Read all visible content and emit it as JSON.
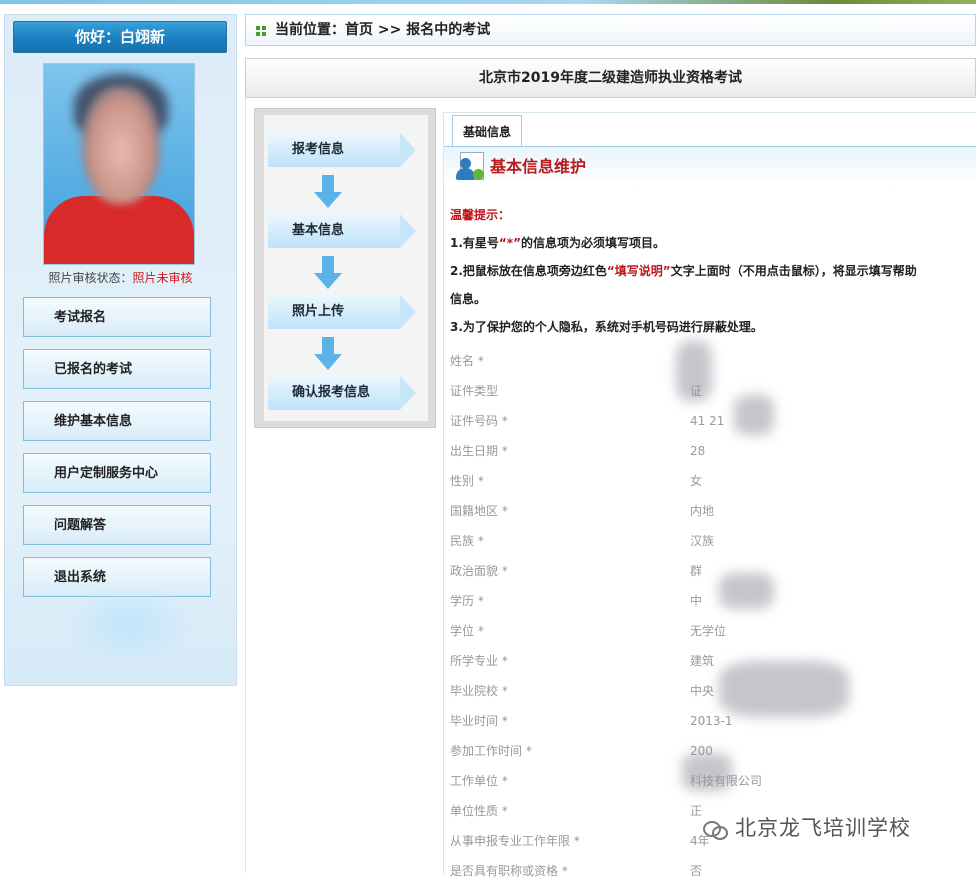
{
  "sidebar": {
    "greeting": "你好：白翊新",
    "photo_status_label": "照片审核状态：",
    "photo_status_value": "照片未审核",
    "menu": [
      {
        "label": "考试报名"
      },
      {
        "label": "已报名的考试"
      },
      {
        "label": "维护基本信息"
      },
      {
        "label": "用户定制服务中心"
      },
      {
        "label": "问题解答"
      },
      {
        "label": "退出系统"
      }
    ]
  },
  "breadcrumb": {
    "text": "当前位置：首页 >> 报名中的考试"
  },
  "exam_title": "北京市2019年度二级建造师执业资格考试",
  "steps": [
    {
      "label": "报考信息"
    },
    {
      "label": "基本信息"
    },
    {
      "label": "照片上传"
    },
    {
      "label": "确认报考信息"
    }
  ],
  "tab": {
    "label": "基础信息"
  },
  "section_title": "基本信息维护",
  "tips": {
    "heading": "温馨提示：",
    "line1_a": "1.有星号",
    "line1_b": "“*”",
    "line1_c": "的信息项为必须填写项目。",
    "line2_a": "2.把鼠标放在信息项旁边红色",
    "line2_b": "“填写说明”",
    "line2_c": "文字上面时（不用点击鼠标），将显示填写帮助",
    "line2_d": "信息。",
    "line3": "3.为了保护您的个人隐私，系统对手机号码进行屏蔽处理。"
  },
  "form": [
    {
      "label": "姓名 *",
      "value": ""
    },
    {
      "label": "证件类型",
      "value": "证"
    },
    {
      "label": "证件号码 *",
      "value": "41                21"
    },
    {
      "label": "出生日期 *",
      "value": "28"
    },
    {
      "label": "性别 *",
      "value": "女"
    },
    {
      "label": "国籍地区 *",
      "value": "内地"
    },
    {
      "label": "民族 *",
      "value": "汉族"
    },
    {
      "label": "政治面貌 *",
      "value": "群"
    },
    {
      "label": "学历 *",
      "value": "中"
    },
    {
      "label": "学位 *",
      "value": "无学位"
    },
    {
      "label": "所学专业 *",
      "value": "建筑"
    },
    {
      "label": "毕业院校 *",
      "value": "中央"
    },
    {
      "label": "毕业时间 *",
      "value": "2013-1"
    },
    {
      "label": "参加工作时间 *",
      "value": "200"
    },
    {
      "label": "工作单位 *",
      "value": "科技有限公司"
    },
    {
      "label": "单位性质 *",
      "value": "正"
    },
    {
      "label": "从事申报专业工作年限 *",
      "value": "4年"
    },
    {
      "label": "是否具有职称或资格 *",
      "value": "否"
    }
  ],
  "watermark": "北京龙飞培训学校"
}
